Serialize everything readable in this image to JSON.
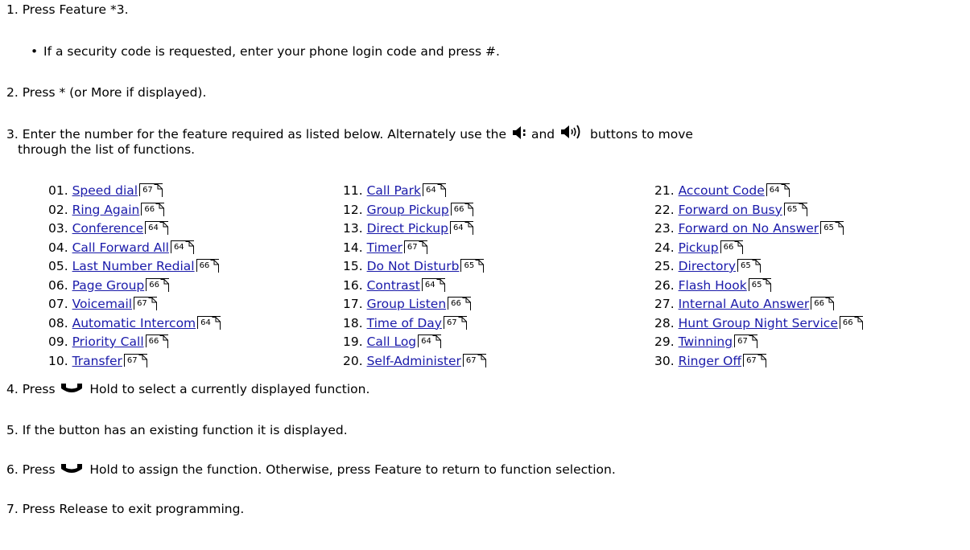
{
  "steps": {
    "s1": {
      "num": "1.",
      "text": "Press Feature *3."
    },
    "s1_bullet": "If a security code is requested, enter your phone login code and press #.",
    "s2": {
      "num": "2.",
      "text": "Press * (or More if displayed)."
    },
    "s3": {
      "num": "3.",
      "pre": "Enter the number for the feature required as listed below. Alternately use the",
      "mid": "and",
      "post": "buttons to move",
      "cont": "through the list of functions."
    },
    "s4": {
      "num": "4.",
      "pre": "Press",
      "post": "Hold to select a currently displayed function."
    },
    "s5": {
      "num": "5.",
      "text": "If the button has an existing function it is displayed."
    },
    "s6": {
      "num": "6.",
      "pre": "Press",
      "post": "Hold to assign the function. Otherwise, press Feature to return to function selection."
    },
    "s7": {
      "num": "7.",
      "text": "Press Release to exit programming."
    }
  },
  "functions": [
    [
      {
        "num": "01.",
        "label": "Speed dial",
        "page": "67"
      },
      {
        "num": "02.",
        "label": "Ring Again",
        "page": "66"
      },
      {
        "num": "03.",
        "label": "Conference",
        "page": "64"
      },
      {
        "num": "04.",
        "label": "Call Forward All",
        "page": "64"
      },
      {
        "num": "05.",
        "label": "Last Number Redial",
        "page": "66"
      },
      {
        "num": "06.",
        "label": "Page Group",
        "page": "66"
      },
      {
        "num": "07.",
        "label": "Voicemail",
        "page": "67"
      },
      {
        "num": "08.",
        "label": "Automatic Intercom",
        "page": "64"
      },
      {
        "num": "09.",
        "label": "Priority Call",
        "page": "66"
      },
      {
        "num": "10.",
        "label": "Transfer",
        "page": "67"
      }
    ],
    [
      {
        "num": "11.",
        "label": "Call Park",
        "page": "64"
      },
      {
        "num": "12.",
        "label": "Group Pickup",
        "page": "66"
      },
      {
        "num": "13.",
        "label": "Direct Pickup",
        "page": "64"
      },
      {
        "num": "14.",
        "label": "Timer",
        "page": "67"
      },
      {
        "num": "15.",
        "label": "Do Not Disturb",
        "page": "65"
      },
      {
        "num": "16.",
        "label": "Contrast",
        "page": "64"
      },
      {
        "num": "17.",
        "label": "Group Listen",
        "page": "66"
      },
      {
        "num": "18.",
        "label": "Time of Day",
        "page": "67"
      },
      {
        "num": "19.",
        "label": "Call Log",
        "page": "64"
      },
      {
        "num": "20.",
        "label": "Self-Administer",
        "page": "67"
      }
    ],
    [
      {
        "num": "21.",
        "label": "Account Code",
        "page": "64"
      },
      {
        "num": "22.",
        "label": "Forward on Busy",
        "page": "65"
      },
      {
        "num": "23.",
        "label": "Forward on No Answer",
        "page": "65"
      },
      {
        "num": "24.",
        "label": "Pickup",
        "page": "66"
      },
      {
        "num": "25.",
        "label": "Directory",
        "page": "65"
      },
      {
        "num": "26.",
        "label": "Flash Hook",
        "page": "65"
      },
      {
        "num": "27.",
        "label": "Internal Auto Answer",
        "page": "66"
      },
      {
        "num": "28.",
        "label": "Hunt Group Night Service",
        "page": "66"
      },
      {
        "num": "29.",
        "label": "Twinning",
        "page": "67"
      },
      {
        "num": "30.",
        "label": "Ringer Off",
        "page": "67"
      }
    ]
  ],
  "icons": {
    "volume_down": "volume-down-icon",
    "volume_up": "volume-up-icon",
    "hold": "handset-icon"
  },
  "link_color": "#1a1aaa"
}
